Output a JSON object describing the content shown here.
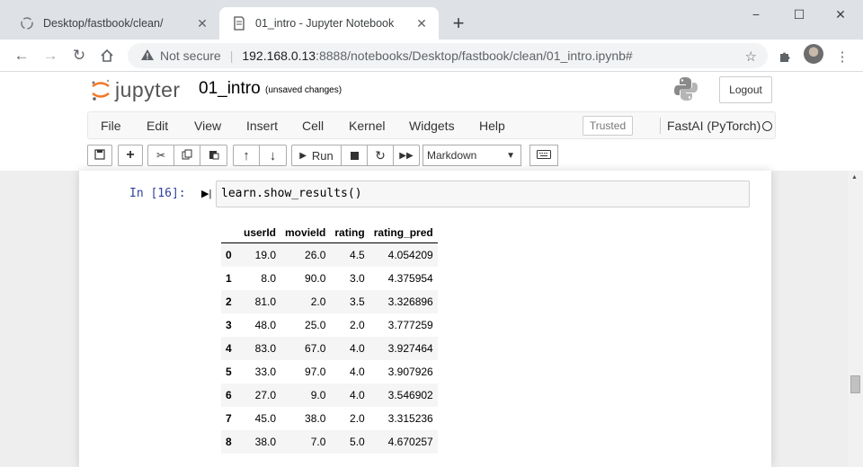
{
  "browser": {
    "tabs": [
      {
        "title": "Desktop/fastbook/clean/",
        "icon": "jupyter-icon"
      },
      {
        "title": "01_intro - Jupyter Notebook",
        "icon": "notebook-icon"
      }
    ],
    "new_tab_symbol": "+",
    "window_controls": {
      "minimize": "−",
      "maximize": "☐",
      "close": "✕"
    },
    "security_label": "Not secure",
    "url_host": "192.168.0.13",
    "url_rest": ":8888/notebooks/Desktop/fastbook/clean/01_intro.ipynb#"
  },
  "jupyter": {
    "logo_text": "jupyter",
    "notebook_name": "01_intro",
    "save_status": "(unsaved changes)",
    "logout_label": "Logout",
    "menu": [
      "File",
      "Edit",
      "View",
      "Insert",
      "Cell",
      "Kernel",
      "Widgets",
      "Help"
    ],
    "trusted_label": "Trusted",
    "kernel_name": "FastAI (PyTorch)",
    "run_label": "Run",
    "cell_type": "Markdown"
  },
  "cell": {
    "prompt": "In [16]:",
    "code": "learn.show_results()"
  },
  "output_table": {
    "columns": [
      "",
      "userId",
      "movieId",
      "rating",
      "rating_pred"
    ],
    "rows": [
      [
        "0",
        "19.0",
        "26.0",
        "4.5",
        "4.054209"
      ],
      [
        "1",
        "8.0",
        "90.0",
        "3.0",
        "4.375954"
      ],
      [
        "2",
        "81.0",
        "2.0",
        "3.5",
        "3.326896"
      ],
      [
        "3",
        "48.0",
        "25.0",
        "2.0",
        "3.777259"
      ],
      [
        "4",
        "83.0",
        "67.0",
        "4.0",
        "3.927464"
      ],
      [
        "5",
        "33.0",
        "97.0",
        "4.0",
        "3.907926"
      ],
      [
        "6",
        "27.0",
        "9.0",
        "4.0",
        "3.546902"
      ],
      [
        "7",
        "45.0",
        "38.0",
        "2.0",
        "3.315236"
      ],
      [
        "8",
        "38.0",
        "7.0",
        "5.0",
        "4.670257"
      ]
    ]
  }
}
